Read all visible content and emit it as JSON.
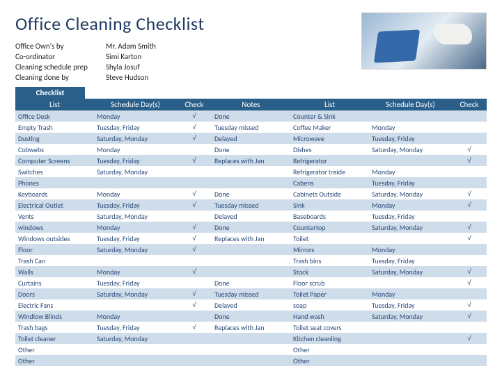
{
  "title": "Office Cleaning Checklist",
  "meta": [
    {
      "label": "Office Own's by",
      "value": "Mr. Adam Smith"
    },
    {
      "label": "Co-ordinator",
      "value": "Simi Karton"
    },
    {
      "label": "Cleaning schedule prep",
      "value": "Shyla Josuf"
    },
    {
      "label": "Cleaning done by",
      "value": "Steve Hudson"
    }
  ],
  "checklist_label": "Checklist",
  "columns": [
    "List",
    "Schedule Day(s)",
    "Check",
    "Notes",
    "List",
    "Schedule Day(s)",
    "Check"
  ],
  "rows": [
    {
      "alt": true,
      "l1": "Office Desk",
      "s1": "Monday",
      "c1": "√",
      "n1": "Done",
      "l2": "Counter & Sink",
      "s2": "",
      "c2": ""
    },
    {
      "alt": false,
      "l1": "Empty Trash",
      "s1": "Tuesday, Friday",
      "c1": "√",
      "n1": "Tuesday missed",
      "l2": "Coffee Maker",
      "s2": "Monday",
      "c2": ""
    },
    {
      "alt": true,
      "l1": "Dusting",
      "s1": "Saturday, Monday",
      "c1": "√",
      "n1": "Delayed",
      "l2": "Microwave",
      "s2": "Tuesday, Friday",
      "c2": ""
    },
    {
      "alt": false,
      "l1": "Cobwebs",
      "s1": "Monday",
      "c1": "",
      "n1": "Done",
      "l2": "Dishes",
      "s2": "Saturday, Monday",
      "c2": "√"
    },
    {
      "alt": true,
      "l1": "Computer Screens",
      "s1": "Tuesday, Friday",
      "c1": "√",
      "n1": "Replaces with Jan",
      "l2": "Refrigerator",
      "s2": "",
      "c2": "√"
    },
    {
      "alt": false,
      "l1": "Switches",
      "s1": "Saturday, Monday",
      "c1": "",
      "n1": "",
      "l2": "Refrigerator Inside",
      "s2": "Monday",
      "c2": ""
    },
    {
      "alt": true,
      "l1": "Phones",
      "s1": "",
      "c1": "",
      "n1": "",
      "l2": "Cabens",
      "s2": "Tuesday, Friday",
      "c2": ""
    },
    {
      "alt": false,
      "l1": "Keyboards",
      "s1": "Monday",
      "c1": "√",
      "n1": "Done",
      "l2": "Cabinets Outside",
      "s2": "Saturday, Monday",
      "c2": "√"
    },
    {
      "alt": true,
      "l1": "Electrical Outlet",
      "s1": "Tuesday, Friday",
      "c1": "√",
      "n1": "Tuesday missed",
      "l2": "Sink",
      "s2": "Monday",
      "c2": "√"
    },
    {
      "alt": false,
      "l1": "Vents",
      "s1": "Saturday, Monday",
      "c1": "",
      "n1": "Delayed",
      "l2": "Baseboards",
      "s2": "Tuesday, Friday",
      "c2": ""
    },
    {
      "alt": true,
      "l1": "windows",
      "s1": "Monday",
      "c1": "√",
      "n1": "Done",
      "l2": "Countertop",
      "s2": "Saturday, Monday",
      "c2": "√"
    },
    {
      "alt": false,
      "l1": "Windows outsides",
      "s1": "Tuesday, Friday",
      "c1": "√",
      "n1": "Replaces with Jan",
      "l2": "Toilet",
      "s2": "",
      "c2": "√"
    },
    {
      "alt": true,
      "l1": "Floor",
      "s1": "Saturday, Monday",
      "c1": "√",
      "n1": "",
      "l2": "Mirrors",
      "s2": "Monday",
      "c2": ""
    },
    {
      "alt": false,
      "l1": "Trash Can",
      "s1": "",
      "c1": "",
      "n1": "",
      "l2": "Trash bins",
      "s2": "Tuesday, Friday",
      "c2": ""
    },
    {
      "alt": true,
      "l1": "Walls",
      "s1": "Monday",
      "c1": "√",
      "n1": "",
      "l2": "Stock",
      "s2": "Saturday, Monday",
      "c2": "√"
    },
    {
      "alt": false,
      "l1": "Curtains",
      "s1": "Tuesday, Friday",
      "c1": "",
      "n1": "Done",
      "l2": "Floor scrub",
      "s2": "",
      "c2": "√"
    },
    {
      "alt": true,
      "l1": "Doors",
      "s1": "Saturday, Monday",
      "c1": "√",
      "n1": "Tuesday missed",
      "l2": "Toilet Paper",
      "s2": "Monday",
      "c2": ""
    },
    {
      "alt": false,
      "l1": "Electric Fans",
      "s1": "",
      "c1": "√",
      "n1": "Delayed",
      "l2": "soap",
      "s2": "Tuesday, Friday",
      "c2": "√"
    },
    {
      "alt": true,
      "l1": "Windlow Blinds",
      "s1": "Monday",
      "c1": "",
      "n1": "Done",
      "l2": "Hand wash",
      "s2": "Saturday, Monday",
      "c2": "√"
    },
    {
      "alt": false,
      "l1": "Trash bags",
      "s1": "Tuesday, Friday",
      "c1": "√",
      "n1": "Replaces with Jan",
      "l2": "Toilet seat covers",
      "s2": "",
      "c2": ""
    },
    {
      "alt": true,
      "l1": "Toilet cleaner",
      "s1": "Saturday, Monday",
      "c1": "",
      "n1": "",
      "l2": "Kitchen cleanling",
      "s2": "",
      "c2": "√"
    },
    {
      "alt": false,
      "l1": "Other",
      "s1": "",
      "c1": "",
      "n1": "",
      "l2": "Other",
      "s2": "",
      "c2": ""
    },
    {
      "alt": true,
      "l1": "Other",
      "s1": "",
      "c1": "",
      "n1": "",
      "l2": "Other",
      "s2": "",
      "c2": ""
    }
  ]
}
